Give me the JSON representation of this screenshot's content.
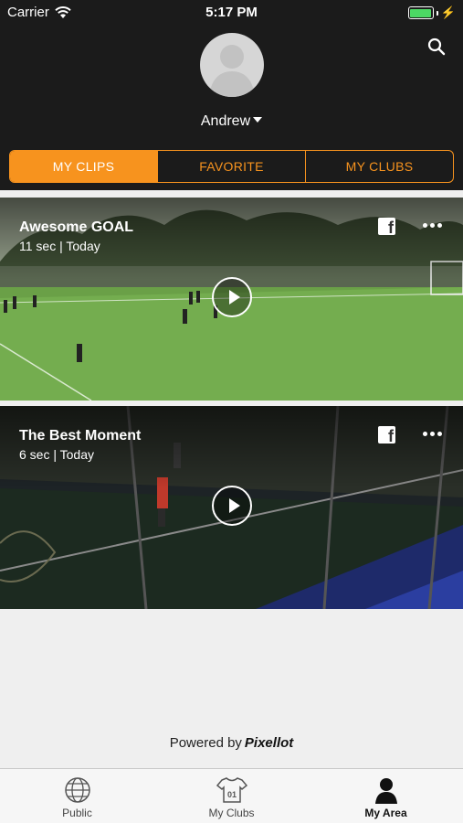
{
  "status_bar": {
    "carrier": "Carrier",
    "time": "5:17 PM",
    "battery_color": "#4cd964"
  },
  "header": {
    "user_name": "Andrew",
    "search_icon": "search-icon",
    "avatar_icon": "avatar-placeholder"
  },
  "segments": {
    "my_clips": "MY CLIPS",
    "favorite": "FAVORITE",
    "my_clubs": "MY CLUBS",
    "active": "MY CLIPS",
    "accent_color": "#f7931e"
  },
  "clips": [
    {
      "title": "Awesome GOAL",
      "meta": "11 sec | Today"
    },
    {
      "title": "The Best Moment",
      "meta": "6 sec | Today"
    }
  ],
  "footer": {
    "powered_by": "Powered by",
    "brand": "Pixellot"
  },
  "tabbar": {
    "public": "Public",
    "my_clubs": "My Clubs",
    "my_area": "My Area",
    "active": "My Area"
  }
}
